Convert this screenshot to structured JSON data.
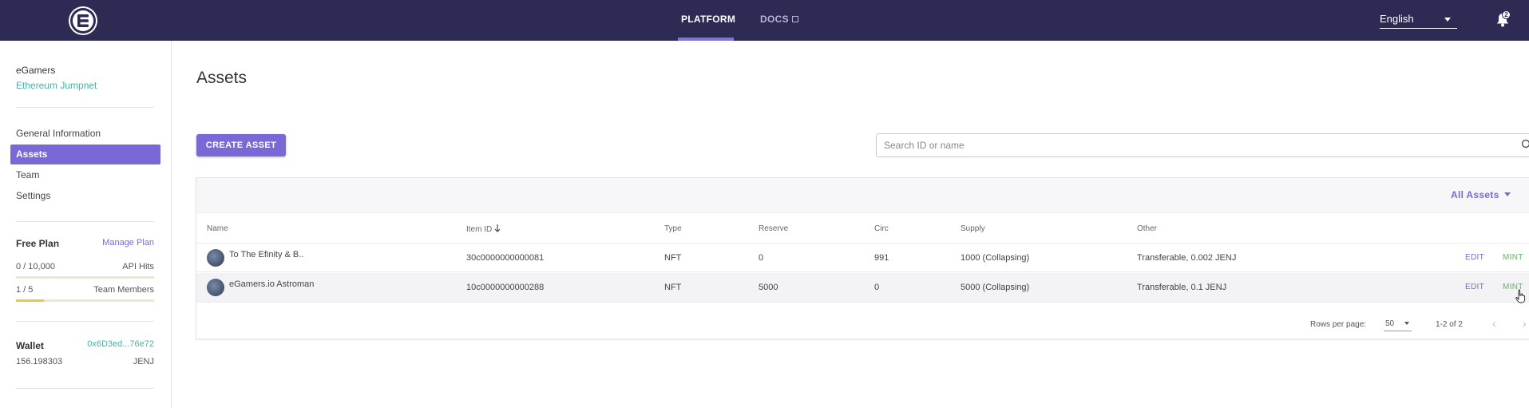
{
  "header": {
    "nav": {
      "platform": "PLATFORM",
      "docs": "DOCS"
    },
    "language": "English",
    "notifications_count": "2"
  },
  "sidebar": {
    "org_name": "eGamers",
    "network": "Ethereum Jumpnet",
    "items": [
      {
        "label": "General Information",
        "active": false
      },
      {
        "label": "Assets",
        "active": true
      },
      {
        "label": "Team",
        "active": false
      },
      {
        "label": "Settings",
        "active": false
      }
    ],
    "plan": {
      "title": "Free Plan",
      "manage": "Manage Plan",
      "api_hits": {
        "value": "0 / 10,000",
        "label": "API Hits",
        "fraction": 0.0
      },
      "team_members": {
        "value": "1 / 5",
        "label": "Team Members",
        "fraction": 0.2
      }
    },
    "wallet": {
      "title": "Wallet",
      "address": "0x6D3ed...76e72",
      "balance": "156.198303",
      "currency": "JENJ"
    }
  },
  "main": {
    "title": "Assets",
    "create_button": "CREATE ASSET",
    "search_placeholder": "Search ID or name",
    "filter": "All Assets",
    "columns": [
      "Name",
      "Item ID",
      "Type",
      "Reserve",
      "Circ",
      "Supply",
      "Other"
    ],
    "rows": [
      {
        "name": "To The Efinity & B..",
        "item_id": "30c0000000000081",
        "type": "NFT",
        "reserve": "0",
        "circ": "991",
        "supply": "1000 (Collapsing)",
        "other": "Transferable, 0.002 JENJ",
        "edit": "EDIT",
        "mint": "MINT"
      },
      {
        "name": "eGamers.io Astroman",
        "item_id": "10c0000000000288",
        "type": "NFT",
        "reserve": "5000",
        "circ": "0",
        "supply": "5000 (Collapsing)",
        "other": "Transferable, 0.1 JENJ",
        "edit": "EDIT",
        "mint": "MINT"
      }
    ],
    "pagination": {
      "rows_per_page_label": "Rows per page:",
      "rows_per_page": "50",
      "range": "1-2 of 2"
    }
  },
  "colors": {
    "header_bg": "#2d2a54",
    "accent": "#7a68d6",
    "network_teal": "#3cb8a8",
    "mint_green": "#5cb85c"
  }
}
